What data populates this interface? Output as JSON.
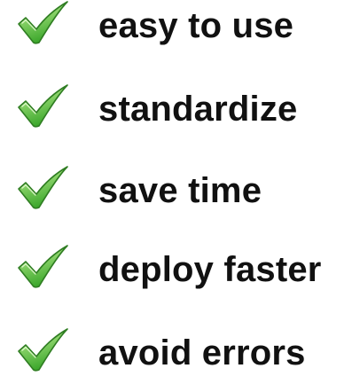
{
  "checklist": {
    "icon": "checkmark-icon",
    "colors": {
      "check_fill_light": "#c8f59a",
      "check_fill_dark": "#3aa62a",
      "check_outline": "#2f7d22"
    },
    "items": [
      {
        "label": "easy to use"
      },
      {
        "label": "standardize"
      },
      {
        "label": "save time"
      },
      {
        "label": "deploy faster"
      },
      {
        "label": "avoid errors"
      }
    ]
  }
}
